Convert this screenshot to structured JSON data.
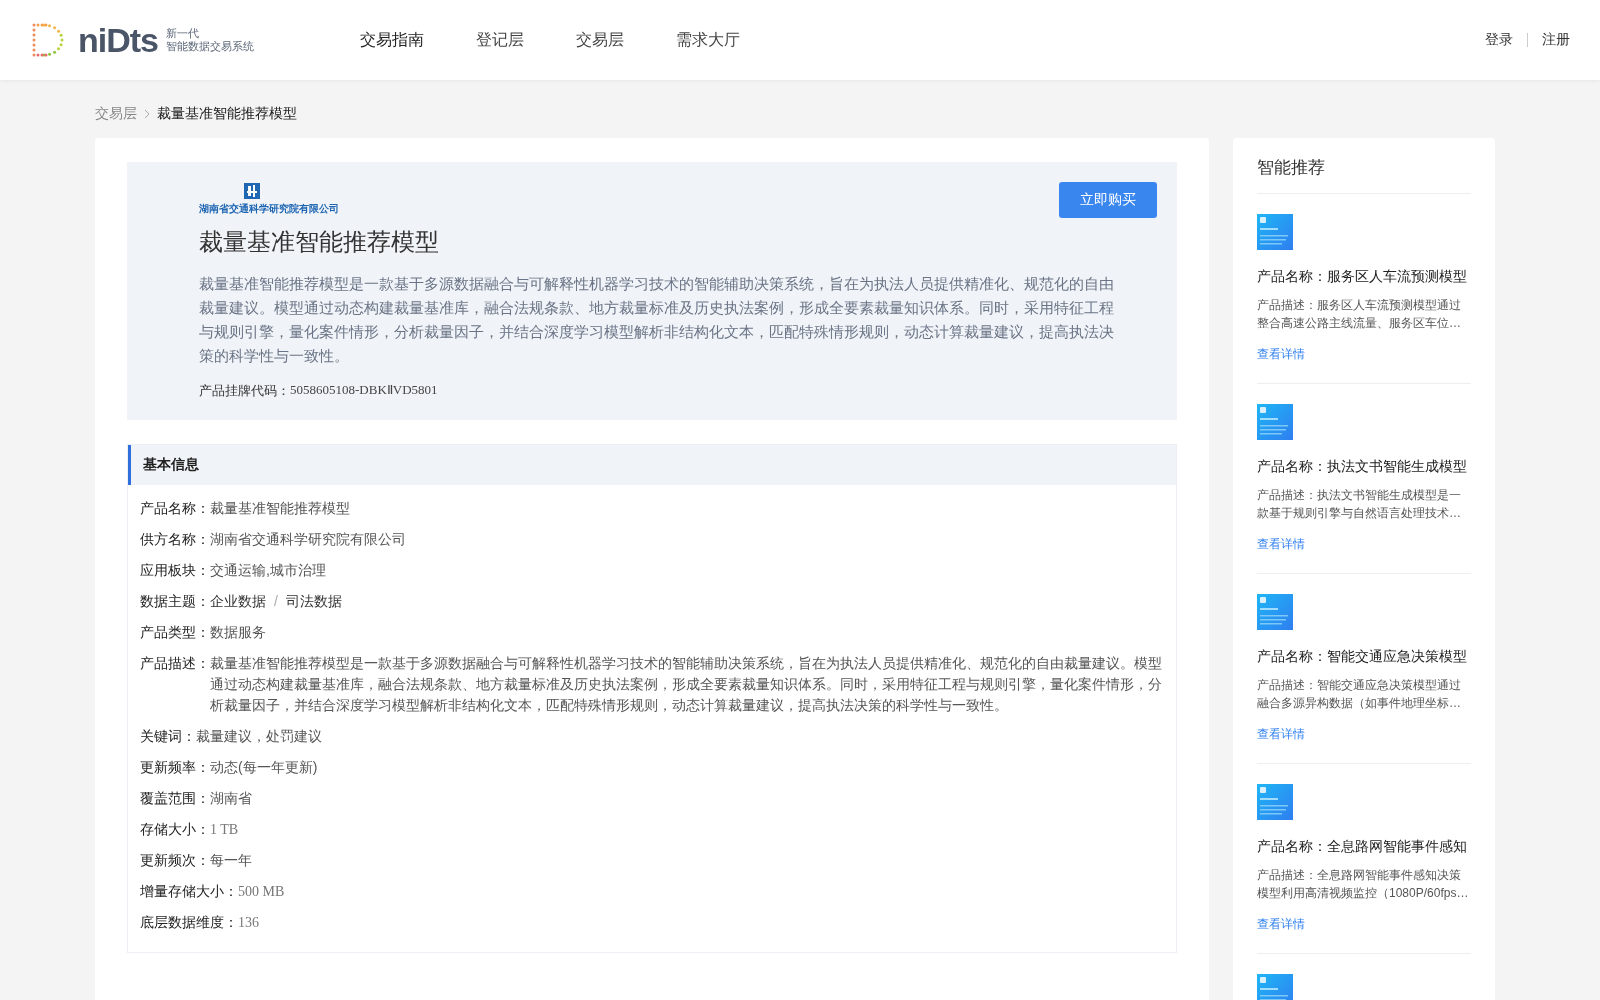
{
  "header": {
    "logo_word": "niDts",
    "logo_line1": "新一代",
    "logo_line2": "智能数据交易系统",
    "nav": [
      {
        "label": "交易指南",
        "selected": true
      },
      {
        "label": "登记层",
        "selected": false
      },
      {
        "label": "交易层",
        "selected": false
      },
      {
        "label": "需求大厅",
        "selected": false
      }
    ],
    "auth": [
      "登录",
      "注册"
    ]
  },
  "breadcrumb": {
    "parent": "交易层",
    "current": "裁量基准智能推荐模型"
  },
  "product": {
    "company_logo_text": "湖南省交通科学研究院有限公司",
    "title": "裁量基准智能推荐模型",
    "description": "裁量基准智能推荐模型是一款基于多源数据融合与可解释性机器学习技术的智能辅助决策系统，旨在为执法人员提供精准化、规范化的自由裁量建议。模型通过动态构建裁量基准库，融合法规条款、地方裁量标准及历史执法案例，形成全要素裁量知识体系。同时，采用特征工程与规则引擎，量化案件情形，分析裁量因子，并结合深度学习模型解析非结构化文本，匹配特殊情形规则，动态计算裁量建议，提高执法决策的科学性与一致性。",
    "code_label": "产品挂牌代码：",
    "code": "5058605108-DBKⅡVD5801",
    "buy_button": "立即购买"
  },
  "basic_info": {
    "title": "基本信息",
    "rows": [
      {
        "kind": "text",
        "label": "产品名称：",
        "value": "裁量基准智能推荐模型"
      },
      {
        "kind": "text",
        "label": "供方名称：",
        "value": "湖南省交通科学研究院有限公司"
      },
      {
        "kind": "text",
        "label": "应用板块：",
        "value": "交通运输,城市治理"
      },
      {
        "kind": "tags",
        "label": "数据主题：",
        "tags": [
          "企业数据",
          "司法数据"
        ],
        "separator": "/"
      },
      {
        "kind": "text",
        "label": "产品类型：",
        "value": "数据服务"
      },
      {
        "kind": "text",
        "label": "产品描述：",
        "value": "裁量基准智能推荐模型是一款基于多源数据融合与可解释性机器学习技术的智能辅助决策系统，旨在为执法人员提供精准化、规范化的自由裁量建议。模型通过动态构建裁量基准库，融合法规条款、地方裁量标准及历史执法案例，形成全要素裁量知识体系。同时，采用特征工程与规则引擎，量化案件情形，分析裁量因子，并结合深度学习模型解析非结构化文本，匹配特殊情形规则，动态计算裁量建议，提高执法决策的科学性与一致性。"
      },
      {
        "kind": "text",
        "label": "关键词：",
        "value": "裁量建议，处罚建议"
      },
      {
        "kind": "text",
        "label": "更新频率：",
        "value": "动态(每一年更新)"
      },
      {
        "kind": "text",
        "label": "覆盖范围：",
        "value": "湖南省"
      },
      {
        "kind": "number",
        "label": "存储大小：",
        "value": "1 TB"
      },
      {
        "kind": "text",
        "label": "更新频次：",
        "value": "每一年"
      },
      {
        "kind": "number",
        "label": "增量存储大小：",
        "value": "500 MB"
      },
      {
        "kind": "number",
        "label": "底层数据维度：",
        "value": "136"
      }
    ]
  },
  "recommendations": {
    "title": "智能推荐",
    "items": [
      {
        "kind": "full",
        "name": "产品名称：服务区人车流预测模型",
        "description": "产品描述：服务区人车流预测模型通过整合高速公路主线流量、服务区车位…",
        "link": "查看详情"
      },
      {
        "kind": "full",
        "name": "产品名称：执法文书智能生成模型",
        "description": "产品描述：执法文书智能生成模型是一款基于规则引擎与自然语言处理技术…",
        "link": "查看详情"
      },
      {
        "kind": "full",
        "name": "产品名称：智能交通应急决策模型",
        "description": "产品描述：智能交通应急决策模型通过融合多源异构数据（如事件地理坐标…",
        "link": "查看详情"
      },
      {
        "kind": "full",
        "name": "产品名称：全息路网智能事件感知",
        "description": "产品描述：全息路网智能事件感知决策模型利用高清视频监控（1080P/60fps…",
        "link": "查看详情"
      },
      {
        "kind": "partial"
      }
    ]
  }
}
